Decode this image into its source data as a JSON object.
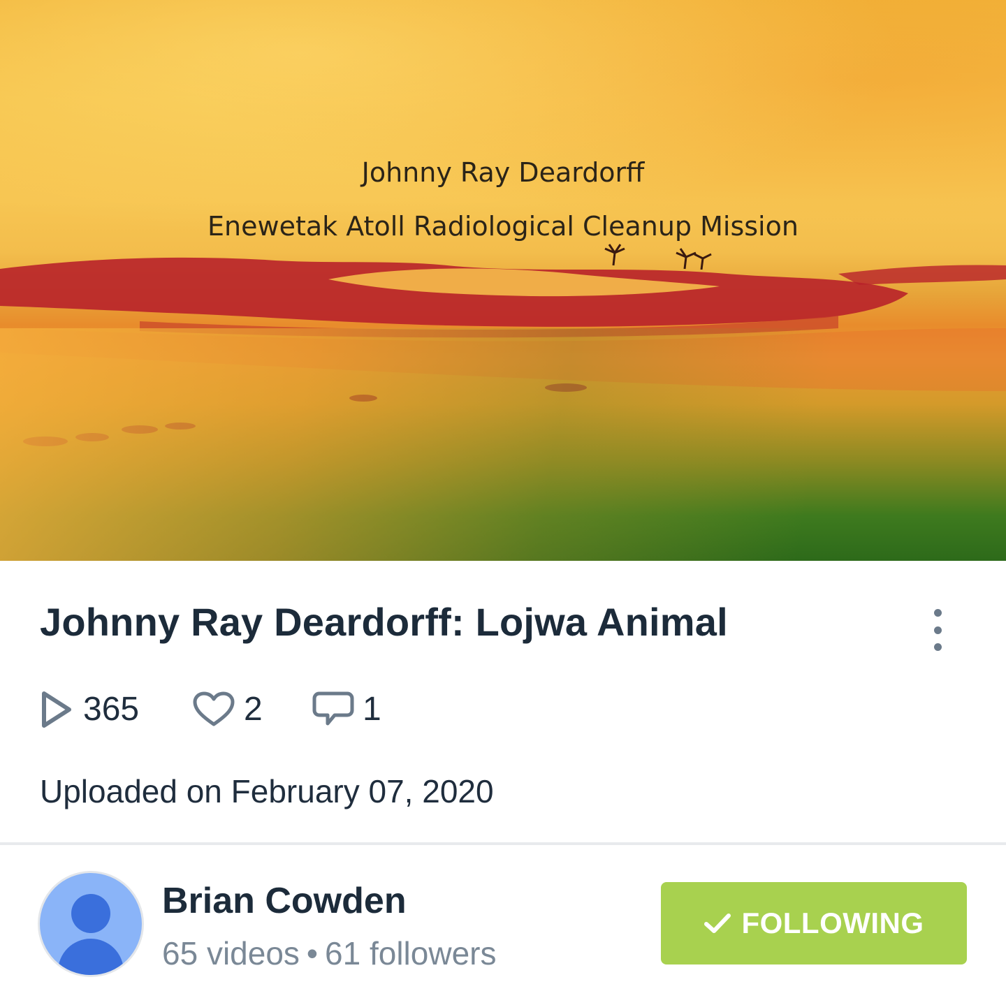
{
  "thumbnail": {
    "caption_line1": "Johnny Ray Deardorff",
    "caption_line2": "Enewetak Atoll Radiological Cleanup Mission"
  },
  "video": {
    "title": "Johnny Ray Deardorff: Lojwa Animal",
    "views": "365",
    "likes": "2",
    "comments": "1",
    "uploaded": "Uploaded on February 07, 2020",
    "menu_icon": "more-vertical-icon"
  },
  "channel": {
    "name": "Brian Cowden",
    "videos": "65 videos",
    "separator": "•",
    "followers": "61 followers",
    "follow_label": "FOLLOWING",
    "follow_icon": "check-icon"
  },
  "colors": {
    "follow_button": "#a8d14f",
    "title_text": "#1c2b3a",
    "meta_text": "#7a8896",
    "icon": "#6b7a8a",
    "avatar_bg": "#8ab4f8",
    "avatar_fg": "#3a6fdc"
  }
}
